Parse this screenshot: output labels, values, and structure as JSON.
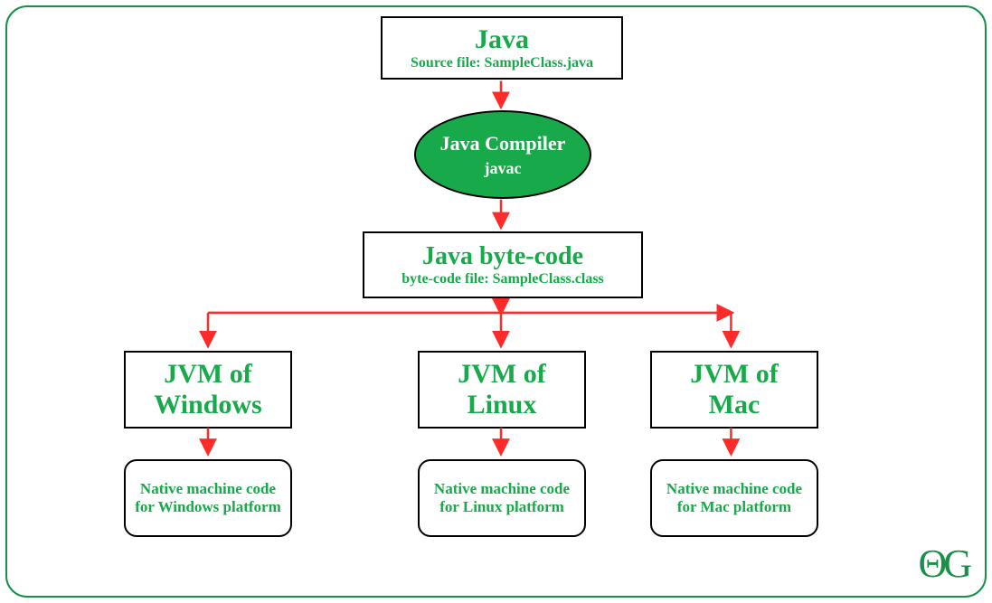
{
  "source": {
    "title": "Java",
    "subtitle": "Source file: SampleClass.java"
  },
  "compiler": {
    "title": "Java Compiler",
    "subtitle": "javac"
  },
  "bytecode": {
    "title": "Java byte-code",
    "subtitle": "byte-code file: SampleClass.class"
  },
  "jvms": [
    {
      "title1": "JVM of",
      "title2": "Windows",
      "native": "Native machine code for Windows platform"
    },
    {
      "title1": "JVM of",
      "title2": "Linux",
      "native": "Native machine code for Linux platform"
    },
    {
      "title1": "JVM of",
      "title2": "Mac",
      "native": "Native machine code for Mac platform"
    }
  ],
  "watermark": "ΘG",
  "colors": {
    "green": "#18a94a",
    "arrow": "#ff2b2b",
    "border": "#1b8f4a"
  }
}
